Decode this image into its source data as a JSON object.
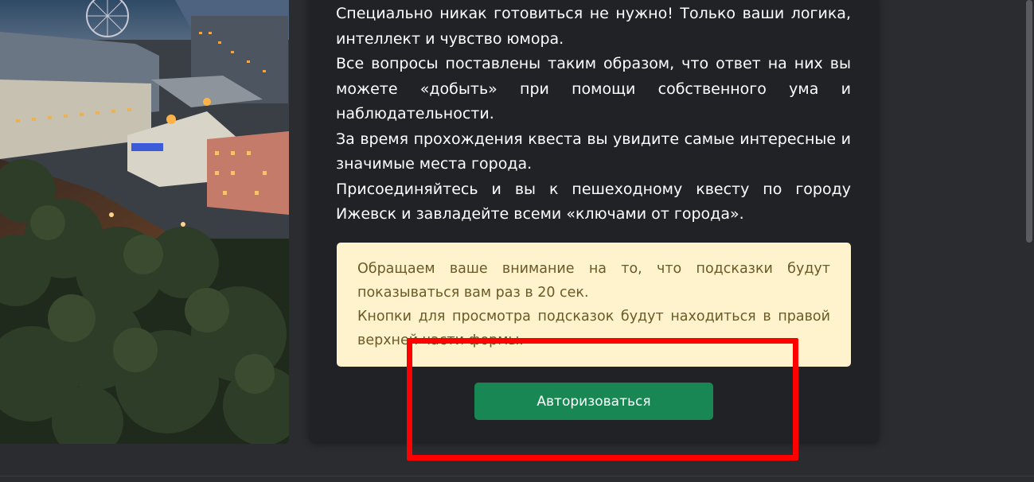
{
  "photo": {
    "icon": "city-night-photo"
  },
  "intro": {
    "paragraphs": [
      "Специально никак готовиться не нужно! Только ваши логика, интеллект и чувство юмора.",
      "Все вопросы поставлены таким образом, что ответ на них вы можете «добыть» при помощи собственного ума и наблюдательности.",
      "За время прохождения квеста вы увидите самые интересные и значимые места города.",
      "Присоединяйтесь и вы к пешеходному квесту по городу Ижевск и завладейте всеми «ключами от города»."
    ]
  },
  "notice": {
    "paragraphs": [
      "Обращаем ваше внимание на то, что подсказки будут показываться вам раз в 20 сек.",
      "Кнопки для просмотра подсказок будут находиться в правой верхней части формы."
    ]
  },
  "auth_button": {
    "label": "Авторизоваться"
  },
  "colors": {
    "button": "#198754",
    "notice_bg": "#fff3cd",
    "highlight": "#ff0000"
  }
}
